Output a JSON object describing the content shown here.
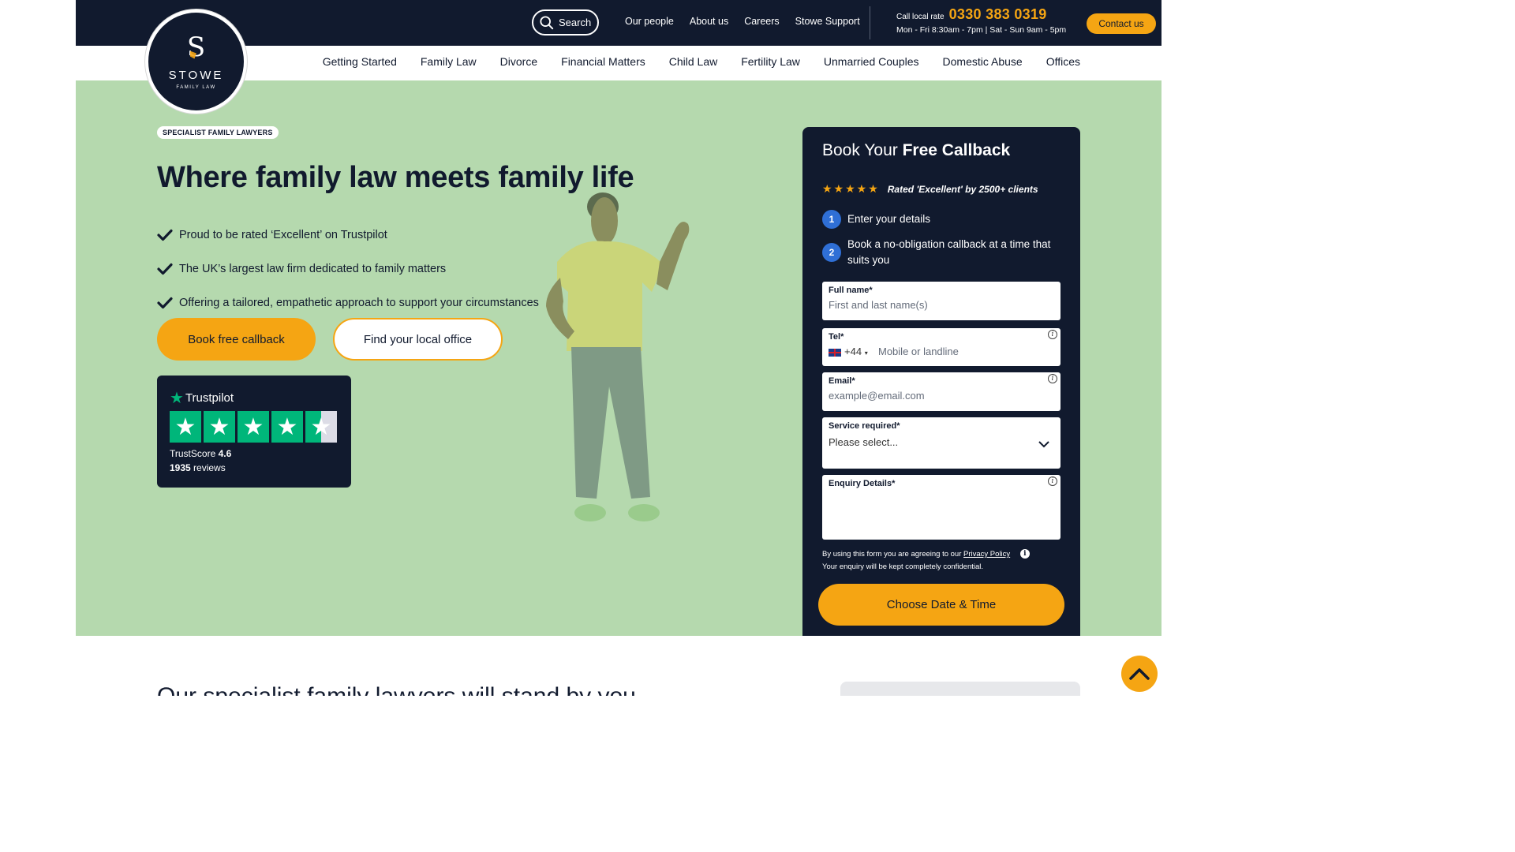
{
  "brand": {
    "logo_letter": "S",
    "logo_name": "STOWE",
    "logo_sub": "FAMILY LAW"
  },
  "topbar": {
    "search_label": "Search",
    "links": [
      "Our people",
      "About us",
      "Careers",
      "Stowe Support"
    ],
    "call_label": "Call local rate",
    "phone": "0330 383 0319",
    "hours": "Mon - Fri 8:30am - 7pm | Sat - Sun 9am - 5pm",
    "contact_label": "Contact us"
  },
  "nav": {
    "items": [
      "Getting Started",
      "Family Law",
      "Divorce",
      "Financial Matters",
      "Child Law",
      "Fertility Law",
      "Unmarried Couples",
      "Domestic Abuse",
      "Offices"
    ]
  },
  "hero": {
    "badge": "SPECIALIST FAMILY LAWYERS",
    "title": "Where family law meets family life",
    "points": [
      "Proud to be rated ‘Excellent’ on Trustpilot",
      "The UK’s largest law firm dedicated to family matters",
      "Offering a tailored, empathetic approach to support your circumstances"
    ],
    "book_label": "Book free callback",
    "office_label": "Find your local office"
  },
  "trustpilot": {
    "brand": "Trustpilot",
    "score_label": "TrustScore",
    "score": "4.6",
    "reviews_count": "1935",
    "reviews_label": "reviews",
    "stars": 4.6
  },
  "form": {
    "title_prefix": "Book Your",
    "title_bold": "Free Callback",
    "rating_text": "Rated 'Excellent' by 2500+ clients",
    "steps": [
      {
        "num": "1",
        "text": "Enter your details"
      },
      {
        "num": "2",
        "text": "Book a no-obligation callback at a time that suits you"
      }
    ],
    "fields": {
      "name": {
        "label": "Full name*",
        "placeholder": "First and last name(s)"
      },
      "tel": {
        "label": "Tel*",
        "code": "+44",
        "placeholder": "Mobile or landline"
      },
      "email": {
        "label": "Email*",
        "placeholder": "example@email.com"
      },
      "service": {
        "label": "Service required*",
        "placeholder": "Please select..."
      },
      "enquiry": {
        "label": "Enquiry Details*",
        "placeholder": ""
      }
    },
    "privacy_prefix": "By using this form you are agreeing to our",
    "privacy_link": "Privacy Policy",
    "confidential": "Your enquiry will be kept completely confidential.",
    "submit_label": "Choose Date & Time"
  },
  "below": {
    "title": "Our specialist family lawyers will stand by you"
  },
  "colors": {
    "navy": "#111a2e",
    "accent": "#f5a513",
    "hero_bg": "#b5d9ae",
    "trust_green": "#00b67a",
    "step_blue": "#2f6fd6"
  }
}
